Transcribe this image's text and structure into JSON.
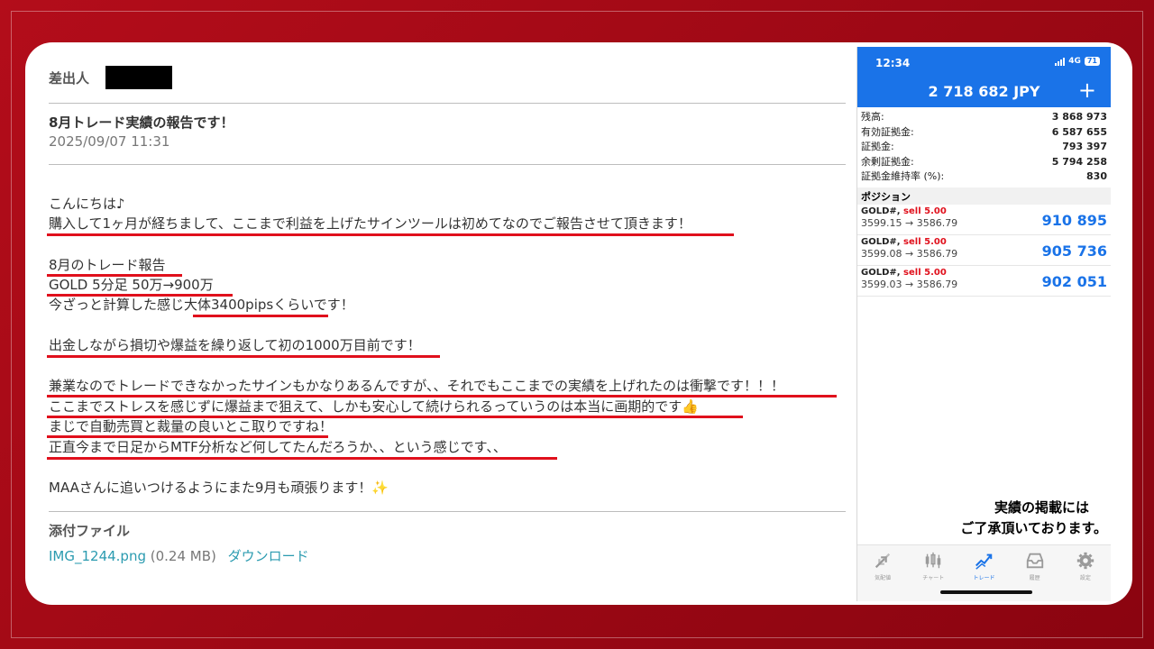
{
  "email": {
    "sender_label": "差出人",
    "subject": "8月トレード実績の報告です！",
    "date": "2025/09/07 11:31",
    "body_lines": [
      "こんにちは♪",
      "購入して1ヶ月が経ちまして、ここまで利益を上げたサインツールは初めてなのでご報告させて頂きます！",
      "8月のトレード報告",
      "GOLD 5分足 50万→900万",
      "今ざっと計算した感じ大体3400pipsくらいです！",
      "出金しながら損切や爆益を繰り返して初の1000万目前です！",
      "兼業なのでトレードできなかったサインもかなりあるんですが、、それでもここまでの実績を上げれたのは衝撃です！！！",
      "ここまでストレスを感じずに爆益まで狙えて、しかも安心して続けられるっていうのは本当に画期的です👍",
      "まじで自動売買と裁量の良いとこ取りですね！",
      "正直今まで日足からMTF分析など何してたんだろうか、、という感じです、、",
      "MAAさんに追いつけるようにまた9月も頑張ります！✨"
    ],
    "attachments_title": "添付ファイル",
    "attachment": {
      "filename": "IMG_1244.png",
      "size": "(0.24 MB)",
      "download": "ダウンロード"
    }
  },
  "phone": {
    "time": "12:34",
    "network": "4G",
    "battery": "71",
    "balance_header": "2 718 682 JPY",
    "plus": "+",
    "account": [
      {
        "label": "残高:",
        "value": "3 868 973"
      },
      {
        "label": "有効証拠金:",
        "value": "6 587 655"
      },
      {
        "label": "証拠金:",
        "value": "793 397"
      },
      {
        "label": "余剰証拠金:",
        "value": "5 794 258"
      },
      {
        "label": "証拠金維持率 (%):",
        "value": "830"
      }
    ],
    "positions_title": "ポジション",
    "positions": [
      {
        "symbol": "GOLD#,",
        "side": "sell 5.00",
        "prices": "3599.15 → 3586.79",
        "profit": "910 895"
      },
      {
        "symbol": "GOLD#,",
        "side": "sell 5.00",
        "prices": "3599.08 → 3586.79",
        "profit": "905 736"
      },
      {
        "symbol": "GOLD#,",
        "side": "sell 5.00",
        "prices": "3599.03 → 3586.79",
        "profit": "902 051"
      }
    ],
    "tabs": [
      {
        "label": "気配値",
        "icon": "quotes-icon"
      },
      {
        "label": "チャート",
        "icon": "chart-icon"
      },
      {
        "label": "トレード",
        "icon": "trade-icon",
        "active": true
      },
      {
        "label": "履歴",
        "icon": "history-icon"
      },
      {
        "label": "設定",
        "icon": "settings-icon"
      }
    ],
    "accent_color": "#1a73e8",
    "sell_color": "#e0101c"
  },
  "notice": {
    "line1": "実績の掲載には",
    "line2": "ご了承頂いております。"
  }
}
